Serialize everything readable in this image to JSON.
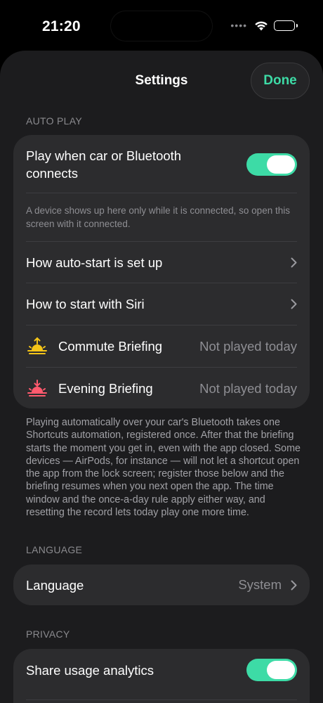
{
  "status": {
    "time": "21:20"
  },
  "nav": {
    "title": "Settings",
    "done_label": "Done"
  },
  "sections": {
    "auto_play": {
      "header": "AUTO PLAY",
      "toggle_label": "Play when car or Bluetooth connects",
      "toggle_on": true,
      "hint": "A device shows up here only while it is connected, so open this screen with it connected.",
      "setup_label": "How auto-start is set up",
      "siri_label": "How to start with Siri",
      "briefings": [
        {
          "icon": "sunrise-icon",
          "color": "#f5c518",
          "name": "Commute Briefing",
          "status": "Not played today"
        },
        {
          "icon": "sunset-icon",
          "color": "#ff5a6e",
          "name": "Evening Briefing",
          "status": "Not played today"
        }
      ],
      "footnote": "Playing automatically over your car's Bluetooth takes one Shortcuts automation, registered once. After that the briefing starts the moment you get in, even with the app closed. Some devices — AirPods, for instance — will not let a shortcut open the app from the lock screen; register those below and the briefing resumes when you next open the app. The time window and the once-a-day rule apply either way, and resetting the record lets today play one more time."
    },
    "language": {
      "header": "LANGUAGE",
      "label": "Language",
      "value": "System"
    },
    "privacy": {
      "header": "PRIVACY",
      "label": "Share usage analytics",
      "toggle_on": true
    }
  },
  "colors": {
    "accent": "#3ddba6",
    "background": "#1c1c1e",
    "card": "#2c2c2e"
  }
}
